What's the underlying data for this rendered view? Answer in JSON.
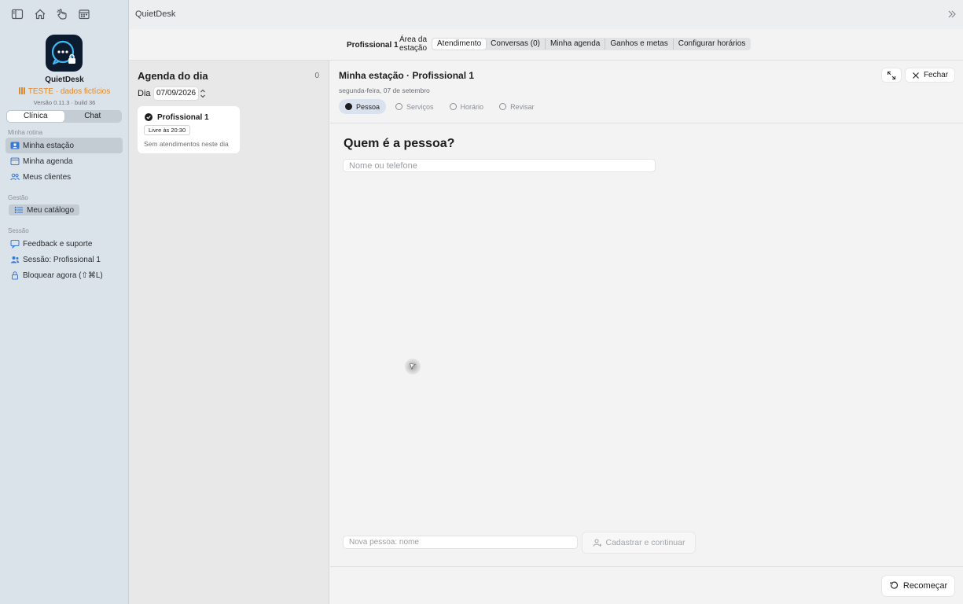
{
  "app": {
    "name": "QuietDesk",
    "test_badge": "TESTE · dados fictícios",
    "version": "Versão 0.11.3 · build 36",
    "window_title": "QuietDesk"
  },
  "sidebar": {
    "mode_tabs": [
      {
        "label": "Clínica",
        "active": true
      },
      {
        "label": "Chat",
        "active": false
      }
    ],
    "sections": {
      "routine": "Minha rotina",
      "management": "Gestão",
      "session": "Sessão"
    },
    "routine_items": [
      {
        "label": "Minha estação",
        "icon": "person-card-icon",
        "selected": true
      },
      {
        "label": "Minha agenda",
        "icon": "calendar-icon",
        "selected": false
      },
      {
        "label": "Meus clientes",
        "icon": "people-icon",
        "selected": false
      }
    ],
    "management_items": [
      {
        "label": "Meu catálogo",
        "icon": "list-icon",
        "selected": true
      }
    ],
    "session_items": [
      {
        "label": "Feedback e suporte",
        "icon": "chat-bubble-icon"
      },
      {
        "label": "Sessão: Profissional 1",
        "icon": "person-icon"
      },
      {
        "label": "Bloquear agora (⇧⌘L)",
        "icon": "lock-icon"
      }
    ]
  },
  "tabbar": {
    "professional": "Profissional 1",
    "area_label": "Área da estação",
    "tabs": [
      {
        "label": "Atendimento",
        "active": true
      },
      {
        "label": "Conversas (0)",
        "active": false
      },
      {
        "label": "Minha agenda",
        "active": false
      },
      {
        "label": "Ganhos e metas",
        "active": false
      },
      {
        "label": "Configurar horários",
        "active": false
      }
    ]
  },
  "agenda": {
    "title": "Agenda do dia",
    "count": "0",
    "day_label": "Dia",
    "date": "07/09/2026",
    "card": {
      "name": "Profissional 1",
      "free": "Livre às 20:30",
      "empty": "Sem atendimentos neste dia"
    }
  },
  "main": {
    "title": "Minha estação · Profissional 1",
    "date": "segunda-feira, 07 de setembro",
    "close_label": "Fechar",
    "steps": [
      {
        "label": "Pessoa",
        "active": true
      },
      {
        "label": "Serviços",
        "active": false
      },
      {
        "label": "Horário",
        "active": false
      },
      {
        "label": "Revisar",
        "active": false
      }
    ],
    "question": "Quem é a pessoa?",
    "search_placeholder": "Nome ou telefone",
    "new_person_placeholder": "Nova pessoa: nome",
    "register_label": "Cadastrar e continuar",
    "restart_label": "Recomeçar"
  },
  "colors": {
    "sidebar_bg": "#dbe3ea",
    "accent": "#3a78d4",
    "test_orange": "#e0892b",
    "logo_bg": "#0d1b2f"
  }
}
